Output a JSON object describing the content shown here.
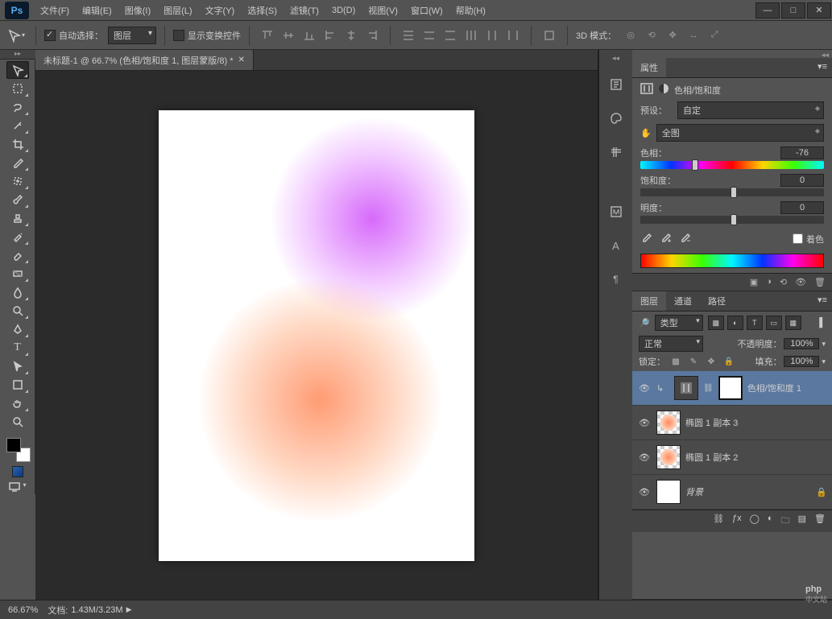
{
  "app": {
    "logo": "Ps"
  },
  "menu": {
    "file": "文件(F)",
    "edit": "编辑(E)",
    "image": "图像(I)",
    "layer": "图层(L)",
    "type": "文字(Y)",
    "select": "选择(S)",
    "filter": "滤镜(T)",
    "threeD": "3D(D)",
    "view": "视图(V)",
    "window": "窗口(W)",
    "help": "帮助(H)"
  },
  "options": {
    "auto_select_label": "自动选择：",
    "target_dropdown": "图层",
    "show_transform_label": "显示变换控件",
    "threeD_mode_label": "3D 模式："
  },
  "document": {
    "tab_title": "未标题-1 @ 66.7% (色相/饱和度 1, 图层蒙版/8) *"
  },
  "panels": {
    "properties": {
      "tab": "属性",
      "adjustment_title": "色相/饱和度",
      "preset_label": "预设：",
      "preset_value": "自定",
      "channel_value": "全图",
      "hue_label": "色相：",
      "hue_value": "-76",
      "sat_label": "饱和度：",
      "sat_value": "0",
      "light_label": "明度：",
      "light_value": "0",
      "colorize_label": "着色"
    },
    "layers": {
      "tabs": {
        "layers": "图层",
        "channels": "通道",
        "paths": "路径"
      },
      "kind_label": "类型",
      "blend_mode": "正常",
      "opacity_label": "不透明度：",
      "opacity_value": "100%",
      "lock_label": "锁定：",
      "fill_label": "填充：",
      "fill_value": "100%",
      "items": [
        {
          "name": "色相/饱和度 1",
          "type": "adjustment",
          "selected": true
        },
        {
          "name": "椭圆 1 副本 3",
          "type": "shape-orange"
        },
        {
          "name": "椭圆 1 副本 2",
          "type": "shape-orange"
        },
        {
          "name": "背景",
          "type": "background",
          "locked": true
        }
      ]
    }
  },
  "status": {
    "zoom": "66.67%",
    "doc_label": "文档:",
    "doc_value": "1.43M/3.23M"
  },
  "watermark": {
    "main": "php",
    "sub": "中文站"
  }
}
